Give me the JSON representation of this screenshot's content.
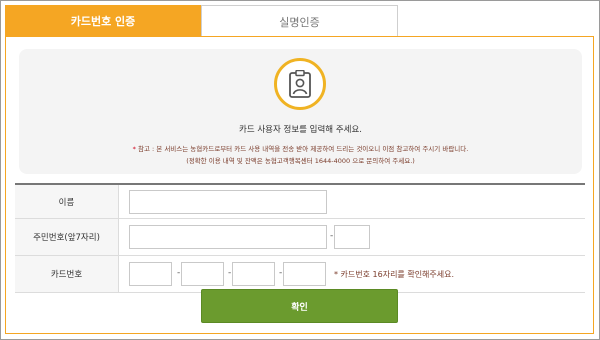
{
  "tabs": [
    {
      "label": "카드번호 인증",
      "active": true
    },
    {
      "label": "실명인증",
      "active": false
    }
  ],
  "notice": {
    "icon": "id-card-icon",
    "main": "카드 사용자 정보를 입력해 주세요.",
    "star": "*",
    "note1": "참고 : 본 서비스는 농협카드로부터 카드 사용 내역을 전송 받아 제공하여 드리는 것이오니 이점 참고하여 주시기 바랍니다.",
    "note2": "(정확한 이용 내역 및 잔액은 농협고객행복센터 1644-4000 으로 문의하여 주세요.)"
  },
  "form": {
    "name_label": "이름",
    "resident_label": "주민번호(앞7자리)",
    "card_label": "카드번호",
    "dash": "-",
    "card_hint": "* 카드번호 16자리를 확인해주세요."
  },
  "confirm_label": "확인",
  "colors": {
    "accent": "#f5a623",
    "confirm": "#6b9b2e",
    "note": "#7a3b2a"
  }
}
